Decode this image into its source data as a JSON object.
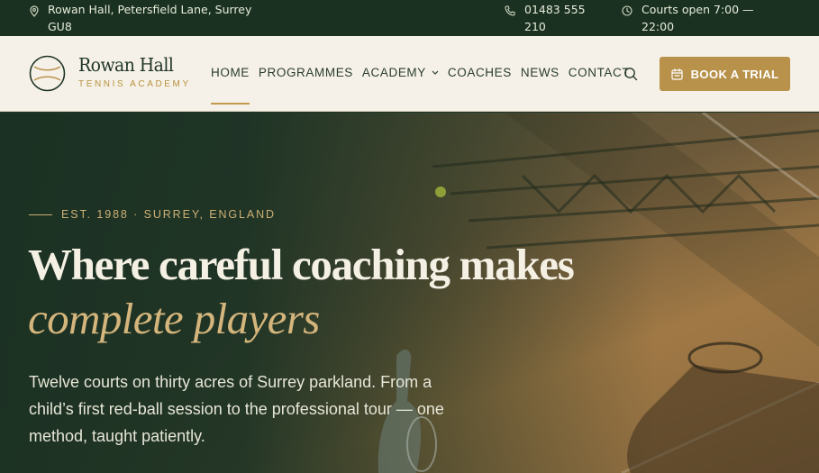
{
  "topbar": {
    "address": "Rowan Hall, Petersfield Lane, Surrey GU8",
    "phone": "01483 555 210",
    "hours": "Courts open 7:00 — 22:00"
  },
  "brand": {
    "name": "Rowan Hall",
    "subtitle": "TENNIS ACADEMY"
  },
  "nav": {
    "items": [
      {
        "label": "HOME"
      },
      {
        "label": "PROGRAMMES"
      },
      {
        "label": "ACADEMY"
      },
      {
        "label": "COACHES"
      },
      {
        "label": "NEWS"
      },
      {
        "label": "CONTACT"
      }
    ],
    "active": "HOME"
  },
  "cta": {
    "label": "BOOK A TRIAL"
  },
  "hero": {
    "eyebrow": "EST. 1988 · SURREY, ENGLAND",
    "headline_line1": "Where careful coaching makes",
    "headline_line2": "complete players",
    "lead": "Twelve courts on thirty acres of Surrey parkland. From a child’s first red-ball session to the professional tour — one method, taught patiently."
  },
  "colors": {
    "forest": "#1a3122",
    "cream": "#f6f1e8",
    "gold": "#b8924b",
    "gold_text": "#d4b57c"
  },
  "icons": {
    "address": "map-pin-icon",
    "phone": "phone-icon",
    "hours": "clock-icon",
    "search": "search-icon",
    "cta": "calendar-icon",
    "dropdown": "chevron-down-icon",
    "logo": "tennis-ball-icon"
  }
}
